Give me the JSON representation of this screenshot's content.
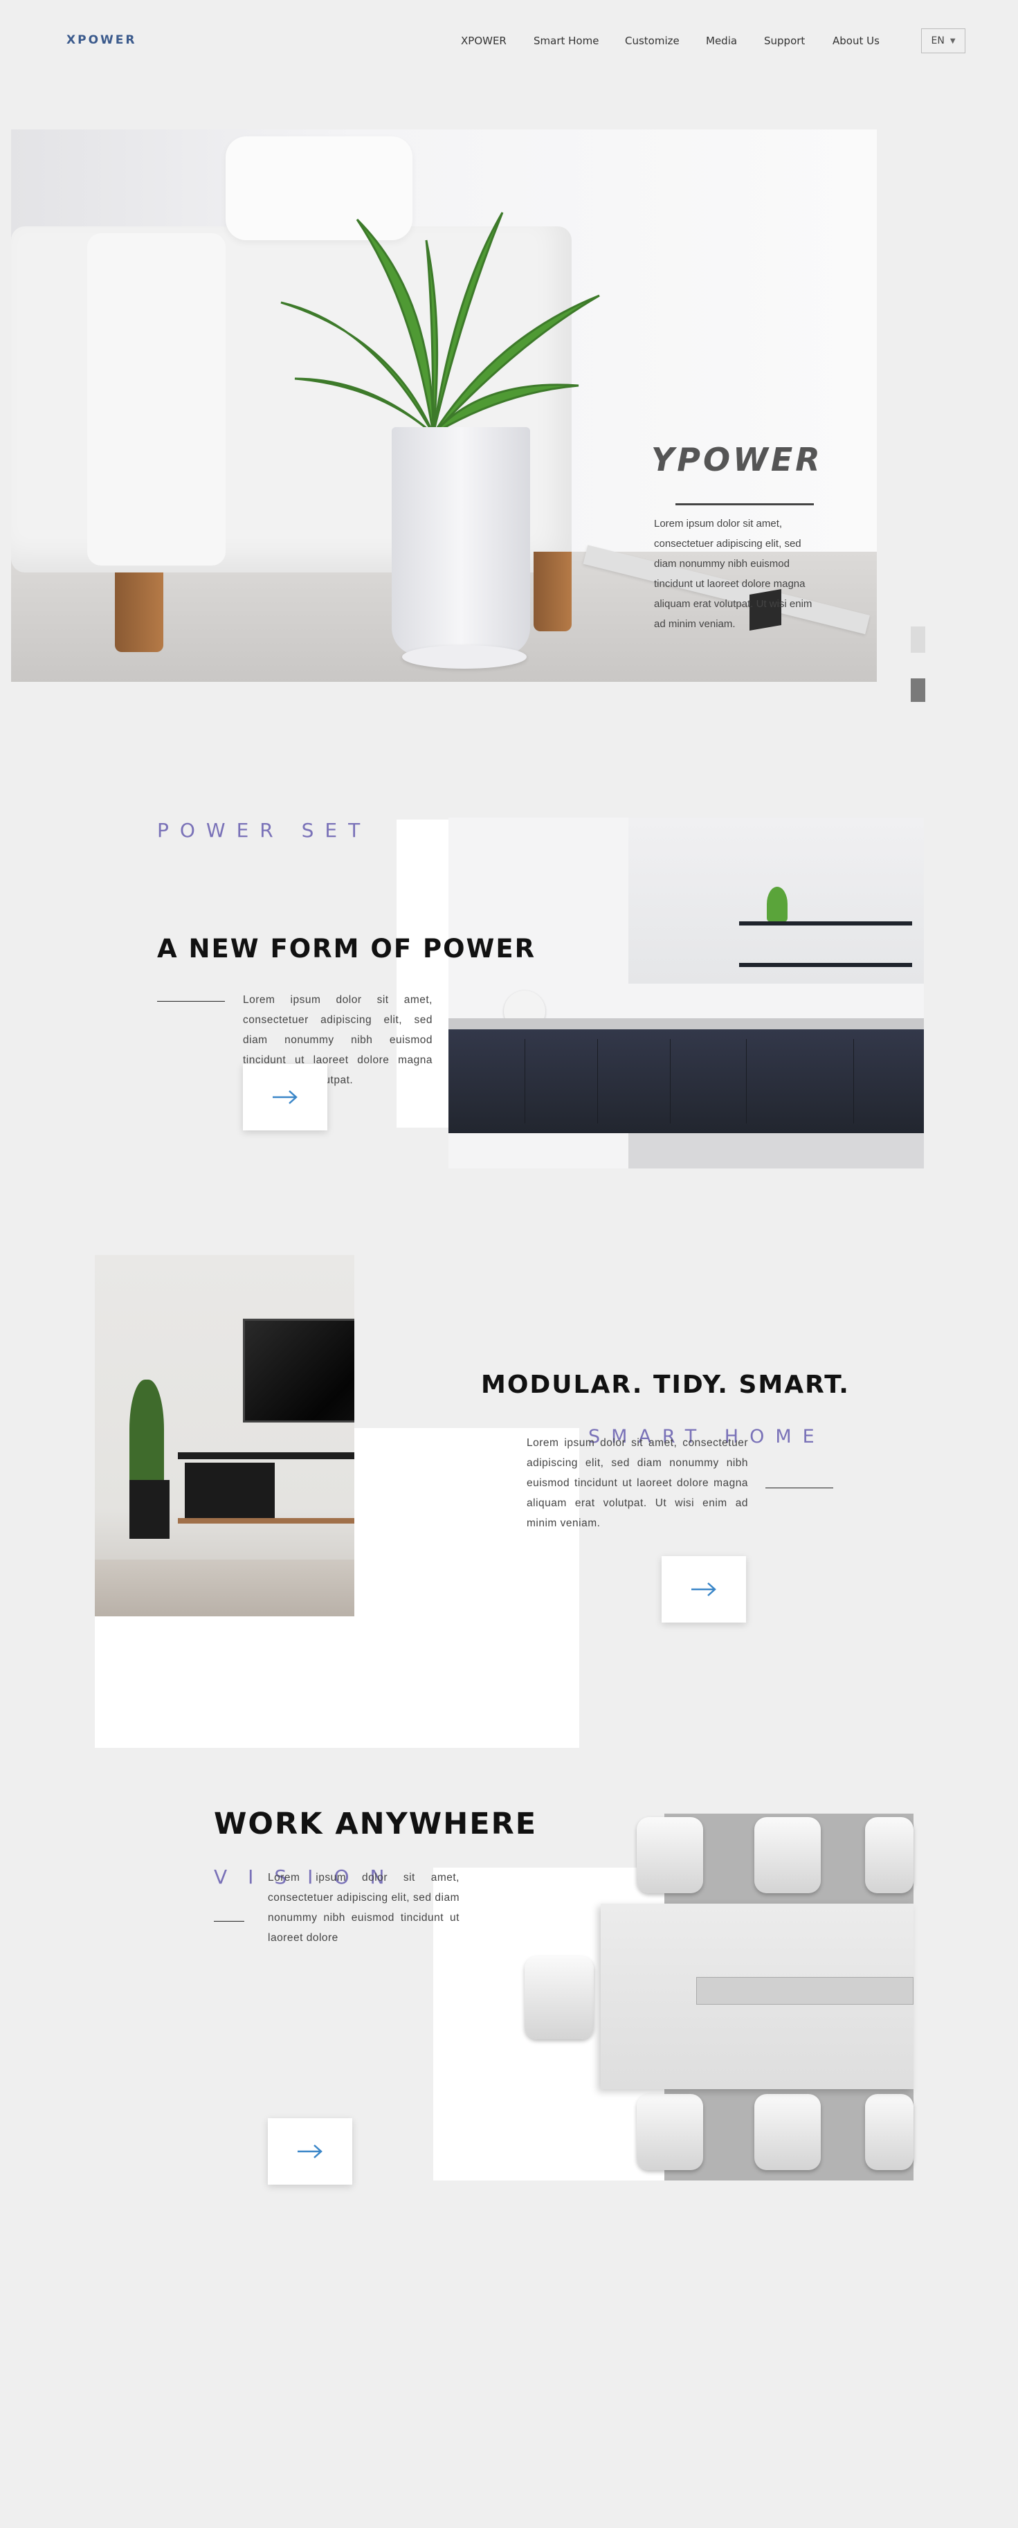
{
  "header": {
    "logo": "XPOWER",
    "nav": [
      "XPOWER",
      "Smart Home",
      "Customize",
      "Media",
      "Support",
      "About Us"
    ],
    "lang": "EN"
  },
  "hero": {
    "brand": "YPOWER",
    "text": "Lorem ipsum dolor sit amet, consectetuer adipiscing elit, sed diam nonummy nibh euismod tincidunt ut laoreet dolore magna aliquam erat volutpat. Ut wisi enim ad minim veniam."
  },
  "section_power": {
    "kicker": "POWER SET",
    "title": "A NEW FORM OF POWER",
    "text": "Lorem ipsum dolor sit amet, consectetuer adipiscing elit, sed diam nonummy nibh euismod tincidunt ut laoreet dolore magna aliquam erat volutpat."
  },
  "section_smart": {
    "title": "MODULAR. TIDY. SMART.",
    "kicker": "SMART HOME",
    "text": "Lorem ipsum dolor sit amet, consectetuer adipiscing elit, sed diam nonummy nibh euismod tincidunt ut laoreet dolore magna aliquam erat volutpat. Ut wisi enim ad minim veniam."
  },
  "section_work": {
    "title": "WORK ANYWHERE",
    "kicker": "VISION",
    "text": "Lorem ipsum dolor sit amet, consectetuer adipiscing elit, sed diam nonummy nibh euismod tincidunt ut laoreet dolore"
  },
  "colors": {
    "accent": "#7a72b8",
    "arrow": "#3a86c8",
    "background": "#efefef"
  },
  "icons": {
    "arrow": "arrow-right-icon",
    "caret": "caret-down-icon"
  }
}
